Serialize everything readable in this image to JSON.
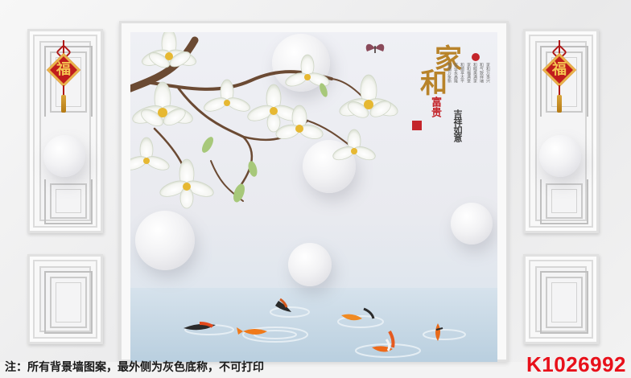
{
  "mural": {
    "title_chars": [
      "家",
      "和"
    ],
    "subtitle_chars": [
      "富",
      "贵"
    ],
    "small_verse": [
      "家和万事兴",
      "和气致祥瑞",
      "和睦美满家",
      "家和福满堂",
      "和顺享太平",
      "家业永昌隆",
      "和谐万象新"
    ],
    "vertical_inscription": "吉祥如意"
  },
  "panels": {
    "knot_glyph": "福"
  },
  "footer": {
    "caption": "注：所有背景墙图案，最外侧为灰色底称，不可打印",
    "product_code": "K1026992"
  },
  "colors": {
    "code_red": "#e8101a",
    "knot_red": "#c01d1d",
    "gold": "#c89232"
  }
}
